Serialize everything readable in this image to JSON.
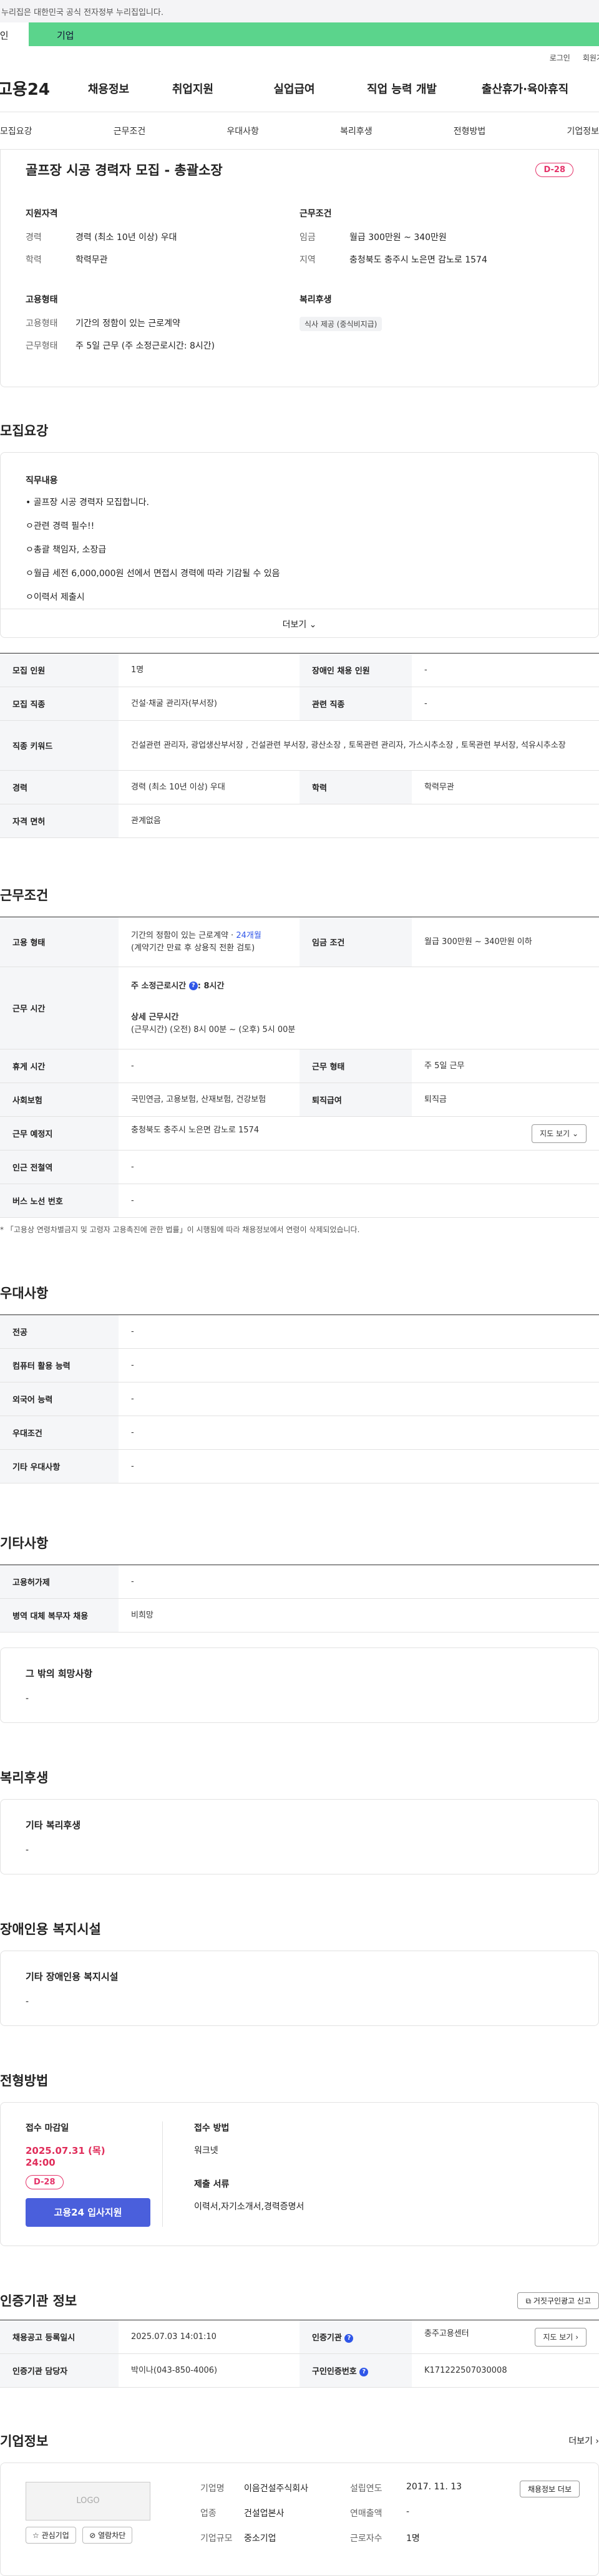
{
  "notice": {
    "text": "이 누리집은 대한민국 공식 전자정부 누리집입니다."
  },
  "top_tabs": {
    "personal": "개인",
    "business": "기업"
  },
  "util": {
    "login": "로그인",
    "signup": "회원가입"
  },
  "gnb": {
    "logo": "고용24",
    "items": [
      "채용정보",
      "취업지원",
      "실업급여",
      "직업 능력 개발",
      "출산휴가·육아휴직"
    ]
  },
  "subnav": [
    "모집요강",
    "근무조건",
    "우대사항",
    "복리후생",
    "전형방법",
    "기업정보"
  ],
  "job": {
    "title": "골프장 시공 경력자 모집 - 총괄소장",
    "dday": "D-28",
    "qual_head": "지원자격",
    "qual": [
      {
        "k": "경력",
        "v": "경력 (최소 10년 이상) 우대"
      },
      {
        "k": "학력",
        "v": "학력무관"
      }
    ],
    "cond_head": "근무조건",
    "cond": [
      {
        "k": "임금",
        "v": "월급 300만원 ~ 340만원"
      },
      {
        "k": "지역",
        "v": "충청북도 충주시 노은면 감노로 1574"
      }
    ],
    "emp_head": "고용형태",
    "emp": [
      {
        "k": "고용형태",
        "v": "기간의 정함이 있는 근로계약"
      },
      {
        "k": "근무형태",
        "v": "주 5일 근무 (주 소정근로시간: 8시간)"
      }
    ],
    "welfare_head": "복리후생",
    "welfare_chip": "식사 제공 (중식비지급)"
  },
  "recruit": {
    "title": "모집요강",
    "desc_label": "직무내용",
    "desc_lines": [
      "• 골프장 시공 경력자 모집합니다.",
      "ㅇ관련 경력 필수!!",
      "ㅇ총괄 책임자, 소장급",
      "ㅇ월급 세전 6,000,000원 선에서 면접시 경력에 따라 기감될 수 있음",
      "ㅇ이력서 제출시"
    ],
    "more": "더보기",
    "table": [
      {
        "k1": "모집 인원",
        "v1": "1명",
        "k2": "장애인 채용 인원",
        "v2": "-"
      },
      {
        "k1": "모집 직종",
        "v1": "건설·채굴 관리자(부서장)",
        "k2": "관련 직종",
        "v2": "-"
      },
      {
        "k1": "직종 키워드",
        "v1": "건설관련 관리자, 광업생산부서장 , 건설관련 부서장, 광산소장 , 토목관련 관리자, 가스시추소장 , 토목관련 부서장, 석유시추소장",
        "k2": "",
        "v2": ""
      },
      {
        "k1": "경력",
        "v1": "경력 (최소 10년 이상) 우대",
        "k2": "학력",
        "v2": "학력무관"
      },
      {
        "k1": "자격 면허",
        "v1": "관계없음",
        "k2": "",
        "v2": ""
      }
    ]
  },
  "work": {
    "title": "근무조건",
    "emp_type_k": "고용 형태",
    "emp_type_v1": "기간의 정함이 있는 근로계약 · ",
    "emp_type_months": "24개월",
    "emp_type_v2": "(계약기간 만료 후 상용직 전환 검토)",
    "wage_k": "임금 조건",
    "wage_v": "월급 300만원 ~ 340만원 이하",
    "hours_k": "근무 시간",
    "hours_1": "주 소정근로시간",
    "hours_1v": ": 8시간",
    "hours_2": "상세 근무시간",
    "hours_3": "(근무시간) (오전) 8시 00분 ~ (오후) 5시 00분",
    "rest_k": "휴게 시간",
    "rest_v": "-",
    "form_k": "근무 형태",
    "form_v": "주 5일 근무",
    "ins_k": "사회보험",
    "ins_v": "국민연금, 고용보험, 산재보험, 건강보험",
    "sev_k": "퇴직급여",
    "sev_v": "퇴직금",
    "place_k": "근무 예정지",
    "place_v": "충청북도 충주시 노은면 감노로 1574",
    "map_btn": "지도 보기",
    "subway_k": "인근 전철역",
    "subway_v": "-",
    "bus_k": "버스 노선 번호",
    "bus_v": "-",
    "footnote": "* 「고용상 연령차별금지 및 고령자 고용촉진에 관한 법률」이 시행됨에 따라 채용정보에서 연령이 삭제되었습니다."
  },
  "pref": {
    "title": "우대사항",
    "rows": [
      {
        "k": "전공",
        "v": "-"
      },
      {
        "k": "컴퓨터 활용 능력",
        "v": "-"
      },
      {
        "k": "외국어 능력",
        "v": "-"
      },
      {
        "k": "우대조건",
        "v": "-"
      },
      {
        "k": "기타 우대사항",
        "v": "-"
      }
    ]
  },
  "etc": {
    "title": "기타사항",
    "rows": [
      {
        "k": "고용허가제",
        "v": "-"
      },
      {
        "k": "병역 대체 복무자 채용",
        "v": "비희망"
      }
    ],
    "card_label": "그 밖의 희망사항",
    "card_value": "-"
  },
  "benefits": {
    "title": "복리후생",
    "label": "기타 복리후생",
    "value": "-"
  },
  "disabled": {
    "title": "장애인용 복지시설",
    "label": "기타 장애인용 복지시설",
    "value": "-"
  },
  "apply": {
    "title": "전형방법",
    "deadline_label": "접수 마감일",
    "deadline": "2025.07.31 (목) 24:00",
    "dday": "D-28",
    "btn": "고용24 입사지원",
    "method_label": "접수 방법",
    "method": "워크넷",
    "docs_label": "제출 서류",
    "docs": "이력서,자기소개서,경력증명서"
  },
  "cert": {
    "title": "인증기관 정보",
    "report_btn": "거짓구인광고 신고",
    "r1k1": "채용공고 등록일시",
    "r1v1": "2025.07.03 14:01:10",
    "r1k2": "인증기관",
    "r1v2": "충주고용센터",
    "r1btn": "지도 보기",
    "r2k1": "인증기관 담당자",
    "r2v1": "박이나(043-850-4006)",
    "r2k2": "구인인증번호",
    "r2v2": "K171222507030008"
  },
  "company": {
    "title": "기업정보",
    "more": "더보기",
    "logo": "LOGO",
    "fav": "관심기업",
    "block": "열람차단",
    "rows": [
      {
        "k": "기업명",
        "v": "이음건설주식회사",
        "k2": "설립연도",
        "v2": "2017. 11. 13"
      },
      {
        "k": "업종",
        "v": "건설업본사",
        "k2": "연매출액",
        "v2": "-"
      },
      {
        "k": "기업규모",
        "v": "중소기업",
        "k2": "근로자수",
        "v2": "1명"
      }
    ],
    "jobs_btn": "채용정보 더보"
  }
}
